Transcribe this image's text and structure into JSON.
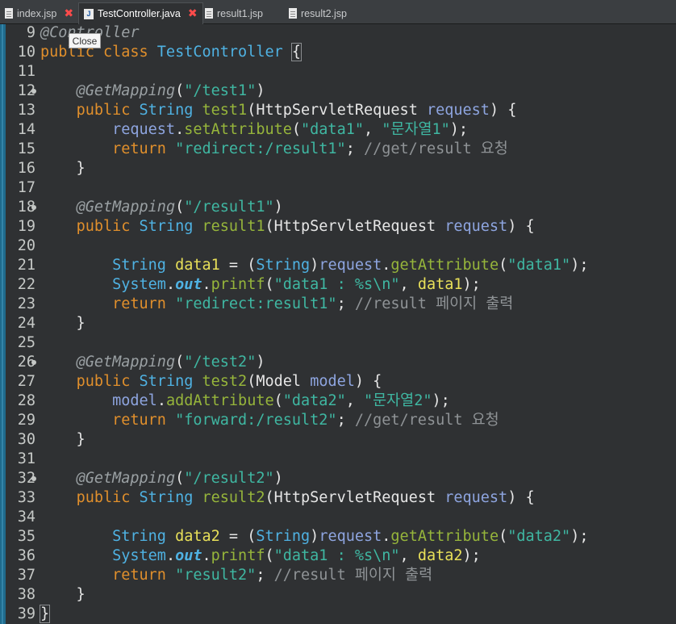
{
  "tabs": [
    {
      "label": "index.jsp",
      "icon": "jsp-file-icon",
      "closable": true
    },
    {
      "label": "TestController.java",
      "icon": "java-file-icon",
      "closable": true
    },
    {
      "label": "result1.jsp",
      "icon": "jsp-file-icon",
      "closable": false
    },
    {
      "label": "result2.jsp",
      "icon": "jsp-file-icon",
      "closable": false
    }
  ],
  "tooltip": "Close",
  "editor": {
    "lines": [
      {
        "n": "9"
      },
      {
        "n": "10"
      },
      {
        "n": "11"
      },
      {
        "n": "12"
      },
      {
        "n": "13"
      },
      {
        "n": "14"
      },
      {
        "n": "15"
      },
      {
        "n": "16"
      },
      {
        "n": "17"
      },
      {
        "n": "18"
      },
      {
        "n": "19"
      },
      {
        "n": "20"
      },
      {
        "n": "21"
      },
      {
        "n": "22"
      },
      {
        "n": "23"
      },
      {
        "n": "24"
      },
      {
        "n": "25"
      },
      {
        "n": "26"
      },
      {
        "n": "27"
      },
      {
        "n": "28"
      },
      {
        "n": "29"
      },
      {
        "n": "30"
      },
      {
        "n": "31"
      },
      {
        "n": "32"
      },
      {
        "n": "33"
      },
      {
        "n": "34"
      },
      {
        "n": "35"
      },
      {
        "n": "36"
      },
      {
        "n": "37"
      },
      {
        "n": "38"
      },
      {
        "n": "39"
      }
    ],
    "code": {
      "l9": {
        "a": "@Controller"
      },
      "l10": {
        "a": "public",
        "b": " class ",
        "c": "TestController",
        "d": " ",
        "e": "{"
      },
      "l12": {
        "a": "    ",
        "b": "@GetMapping",
        "c": "(",
        "d": "\"/test1\"",
        "e": ")"
      },
      "l13": {
        "a": "    ",
        "b": "public",
        "c": " ",
        "d": "String",
        "e": " ",
        "f": "test1",
        "g": "(",
        "h": "HttpServletRequest",
        "i": " ",
        "j": "request",
        "k": ") {"
      },
      "l14": {
        "a": "        ",
        "b": "request",
        "c": ".",
        "d": "setAttribute",
        "e": "(",
        "f": "\"data1\"",
        "g": ", ",
        "h": "\"문자열1\"",
        "i": ");"
      },
      "l15": {
        "a": "        ",
        "b": "return",
        "c": " ",
        "d": "\"redirect:/result1\"",
        "e": "; ",
        "f": "//get/result 요청"
      },
      "l16": {
        "a": "    }"
      },
      "l18": {
        "a": "    ",
        "b": "@GetMapping",
        "c": "(",
        "d": "\"/result1\"",
        "e": ")"
      },
      "l19": {
        "a": "    ",
        "b": "public",
        "c": " ",
        "d": "String",
        "e": " ",
        "f": "result1",
        "g": "(",
        "h": "HttpServletRequest",
        "i": " ",
        "j": "request",
        "k": ") {"
      },
      "l21": {
        "a": "        ",
        "b": "String",
        "c": " ",
        "d": "data1",
        "e": " = (",
        "f": "String",
        "g": ")",
        "h": "request",
        "i": ".",
        "j": "getAttribute",
        "k": "(",
        "l": "\"data1\"",
        "m": ");"
      },
      "l22": {
        "a": "        ",
        "b": "System",
        "c": ".",
        "d": "out",
        "e": ".",
        "f": "printf",
        "g": "(",
        "h": "\"data1 : %s\\n\"",
        "i": ", ",
        "j": "data1",
        "k": ");"
      },
      "l23": {
        "a": "        ",
        "b": "return",
        "c": " ",
        "d": "\"redirect:result1\"",
        "e": "; ",
        "f": "//result 페이지 출력"
      },
      "l24": {
        "a": "    }"
      },
      "l26": {
        "a": "    ",
        "b": "@GetMapping",
        "c": "(",
        "d": "\"/test2\"",
        "e": ")"
      },
      "l27": {
        "a": "    ",
        "b": "public",
        "c": " ",
        "d": "String",
        "e": " ",
        "f": "test2",
        "g": "(",
        "h": "Model",
        "i": " ",
        "j": "model",
        "k": ") {"
      },
      "l28": {
        "a": "        ",
        "b": "model",
        "c": ".",
        "d": "addAttribute",
        "e": "(",
        "f": "\"data2\"",
        "g": ", ",
        "h": "\"문자열2\"",
        "i": ");"
      },
      "l29": {
        "a": "        ",
        "b": "return",
        "c": " ",
        "d": "\"forward:/result2\"",
        "e": "; ",
        "f": "//get/result 요청"
      },
      "l30": {
        "a": "    }"
      },
      "l32": {
        "a": "    ",
        "b": "@GetMapping",
        "c": "(",
        "d": "\"/result2\"",
        "e": ")"
      },
      "l33": {
        "a": "    ",
        "b": "public",
        "c": " ",
        "d": "String",
        "e": " ",
        "f": "result2",
        "g": "(",
        "h": "HttpServletRequest",
        "i": " ",
        "j": "request",
        "k": ") {"
      },
      "l35": {
        "a": "        ",
        "b": "String",
        "c": " ",
        "d": "data2",
        "e": " = (",
        "f": "String",
        "g": ")",
        "h": "request",
        "i": ".",
        "j": "getAttribute",
        "k": "(",
        "l": "\"data2\"",
        "m": ");"
      },
      "l36": {
        "a": "        ",
        "b": "System",
        "c": ".",
        "d": "out",
        "e": ".",
        "f": "printf",
        "g": "(",
        "h": "\"data1 : %s\\n\"",
        "i": ", ",
        "j": "data2",
        "k": ");"
      },
      "l37": {
        "a": "        ",
        "b": "return",
        "c": " ",
        "d": "\"result2\"",
        "e": "; ",
        "f": "//result 페이지 출력"
      },
      "l38": {
        "a": "    }"
      },
      "l39": {
        "a": "}"
      }
    }
  }
}
